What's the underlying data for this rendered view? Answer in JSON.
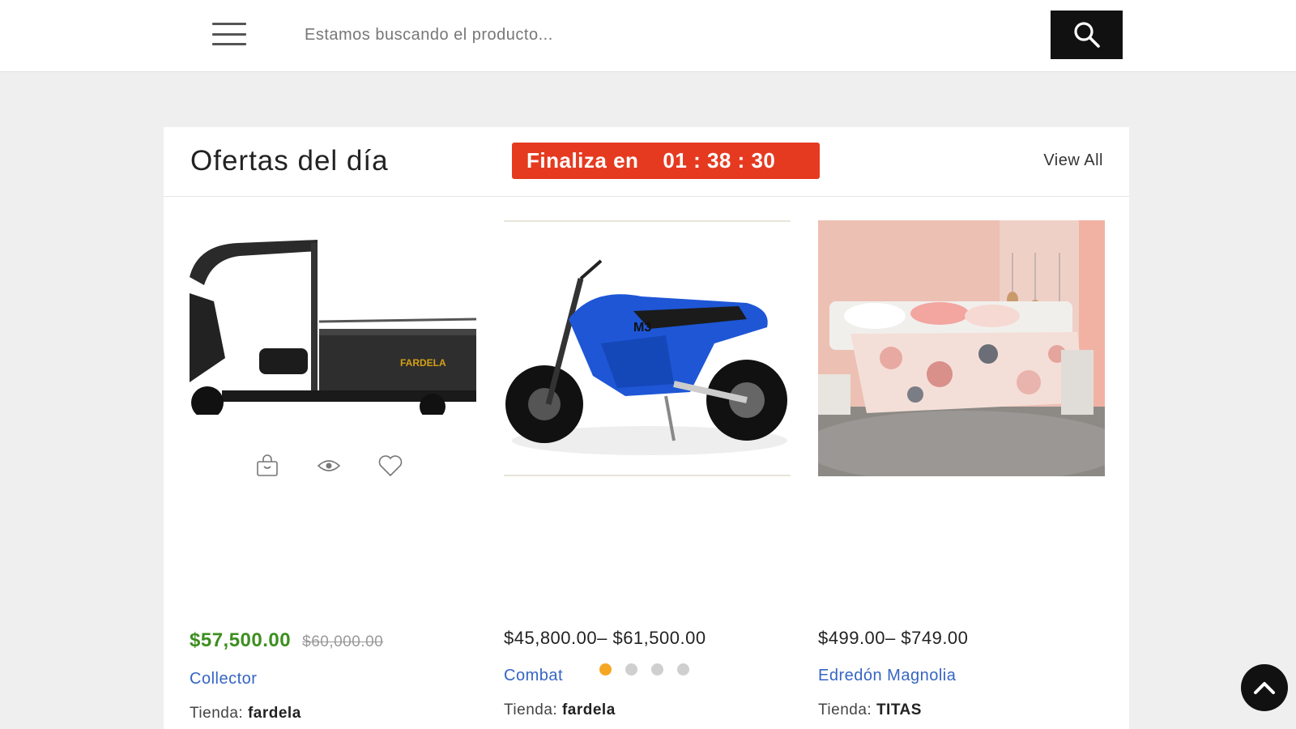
{
  "header": {
    "search_placeholder": "Estamos buscando el producto..."
  },
  "deals": {
    "title": "Ofertas del día",
    "countdown_label": "Finaliza en",
    "countdown_time": "01 : 38 : 30",
    "view_all": "View All",
    "countdown_color": "#e53a20"
  },
  "products": [
    {
      "sale_price": "$57,500.00",
      "old_price": "$60,000.00",
      "name": "Collector",
      "store_label": "Tienda:",
      "store": "fardela",
      "image": "cargo-tricycle"
    },
    {
      "price": "$45,800.00– $61,500.00",
      "name": "Combat",
      "store_label": "Tienda:",
      "store": "fardela",
      "image": "blue-electric-motorcycle"
    },
    {
      "price": "$499.00– $749.00",
      "name": "Edredón Magnolia",
      "store_label": "Tienda:",
      "store": "TITAS",
      "image": "floral-bedspread-bedroom"
    }
  ],
  "carousel": {
    "pages": 4,
    "active_page": 1,
    "active_color": "#f5a623"
  }
}
